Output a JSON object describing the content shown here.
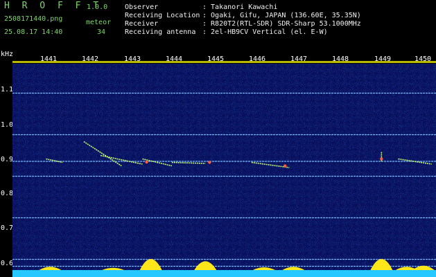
{
  "app": {
    "name": "H R O F F T",
    "version": "1.0.0"
  },
  "file": {
    "name": "2508171440.png",
    "datetime": "25.08.17 14:40"
  },
  "detection": {
    "label": "meteor",
    "count": "34"
  },
  "info": [
    {
      "key": "Observer",
      "value": ": Takanori Kawachi"
    },
    {
      "key": "Receiving Location",
      "value": ": Ogaki, Gifu, JAPAN (136.60E, 35.35N)"
    },
    {
      "key": "Receiver",
      "value": ": R820T2(RTL-SDR) SDR-Sharp 53.1000MHz"
    },
    {
      "key": "Receiving antenna",
      "value": ": 2el-HB9CV Vertical (el. E-W)"
    }
  ],
  "chart_data": {
    "type": "heatmap",
    "ylabel": "kHz",
    "x_ticks": [
      "1441",
      "1442",
      "1443",
      "1444",
      "1445",
      "1446",
      "1447",
      "1448",
      "1449",
      "1450"
    ],
    "y_ticks": [
      "1.1",
      "1.0",
      "0.9",
      "0.8",
      "0.7",
      "0.6"
    ],
    "xlim": [
      1440.2,
      1450.3
    ],
    "ylim": [
      0.6,
      1.2
    ],
    "horizontal_lines_khz": [
      1.115,
      0.995,
      0.918,
      0.875,
      0.755,
      0.635,
      0.615
    ],
    "meteor_echoes": [
      {
        "x0": 1441.0,
        "y0": 0.925,
        "x1": 1441.4,
        "y1": 0.915
      },
      {
        "x0": 1441.9,
        "y0": 0.975,
        "x1": 1442.8,
        "y1": 0.905
      },
      {
        "x0": 1442.3,
        "y0": 0.935,
        "x1": 1443.3,
        "y1": 0.91
      },
      {
        "x0": 1443.3,
        "y0": 0.925,
        "x1": 1444.0,
        "y1": 0.905
      },
      {
        "x0": 1444.0,
        "y0": 0.915,
        "x1": 1444.8,
        "y1": 0.912
      },
      {
        "x0": 1445.9,
        "y0": 0.915,
        "x1": 1446.8,
        "y1": 0.9
      },
      {
        "x0": 1449.0,
        "y0": 0.945,
        "x1": 1449.0,
        "y1": 0.918
      },
      {
        "x0": 1449.4,
        "y0": 0.925,
        "x1": 1450.2,
        "y1": 0.91
      }
    ],
    "carrier_line_khz": 0.918
  }
}
